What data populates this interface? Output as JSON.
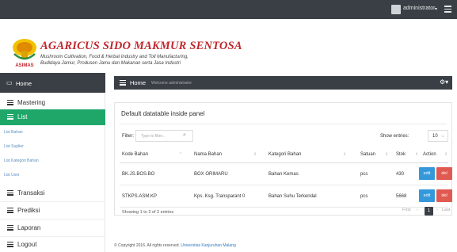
{
  "topbar": {
    "username": "administrator",
    "caret": "▾"
  },
  "brand": {
    "logo_text": "ASIMAS",
    "title": "AGARICUS SIDO MAKMUR SENTOSA",
    "subtitle_line1": "Mushroom Cultivation, Food & Herbal Industry and Toll Manufacturing,",
    "subtitle_line2": "Budidaya Jamur, Produsen Jamu dan Makanan serta Jasa Industri"
  },
  "sidebar": {
    "home_label": "Home",
    "items": [
      {
        "label": "Mastering"
      },
      {
        "label": "List"
      },
      {
        "label": "Transaksi"
      },
      {
        "label": "Prediksi"
      },
      {
        "label": "Laporan"
      },
      {
        "label": "Logout"
      }
    ],
    "sub_items": [
      {
        "label": "List Bahan"
      },
      {
        "label": "List Suplier"
      },
      {
        "label": "List Kategori Bahan"
      },
      {
        "label": "List User"
      }
    ]
  },
  "mainbar": {
    "title": "Home",
    "welcome": "Welcome administrator"
  },
  "panel": {
    "title": "Default datatable inside panel",
    "filter_label": "Filter:",
    "filter_placeholder": "Type to filter...",
    "show_label": "Show entries:",
    "show_value": "10",
    "columns": [
      "Kode Bahan",
      "Nama Bahan",
      "Kategori Bahan",
      "Satuan",
      "Stok",
      "Action"
    ],
    "rows": [
      {
        "kode": "BK.JS.BOS.BO",
        "nama": "BOX ORIMARU",
        "kategori": "Bahan Kemas",
        "satuan": "pcs",
        "stok": "430"
      },
      {
        "kode": "STKPS.ASM.KP",
        "nama": "Kps. Ksg. Transparant 0",
        "kategori": "Bahan Suhu Terkendal",
        "satuan": "pcs",
        "stok": "5668"
      }
    ],
    "edit_label": "edit",
    "del_label": "del",
    "info": "Showing 1 to 2 of 2 entries",
    "pager": {
      "first": "First",
      "prev": "‹",
      "current": "1",
      "next": "›",
      "last": "Last"
    }
  },
  "footer": {
    "text": "© Copyright 2016. All rights reserved.",
    "link": "Universitas Kanjuruhan Malang"
  }
}
